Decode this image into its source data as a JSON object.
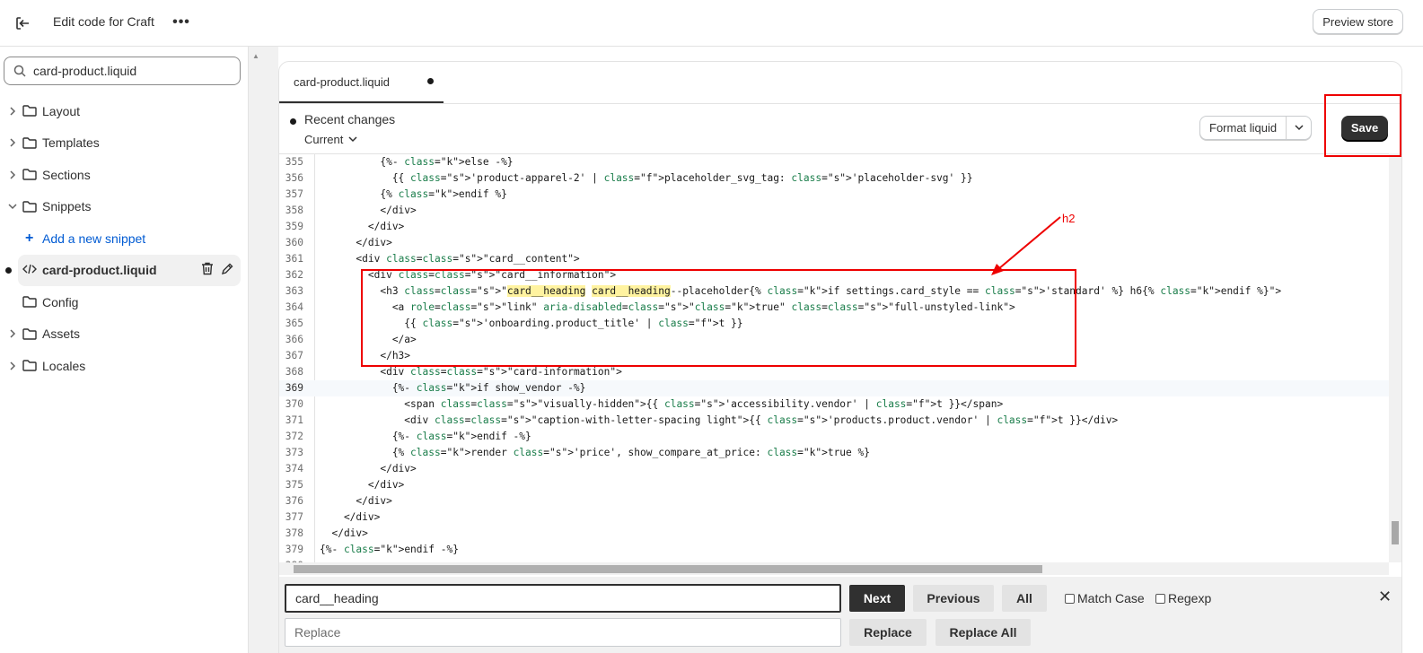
{
  "header": {
    "title": "Edit code for Craft",
    "preview_label": "Preview store"
  },
  "sidebar": {
    "search_value": "card-product.liquid",
    "items": [
      {
        "label": "Layout"
      },
      {
        "label": "Templates"
      },
      {
        "label": "Sections"
      },
      {
        "label": "Snippets"
      },
      {
        "label": "Add a new snippet"
      },
      {
        "label": "card-product.liquid"
      },
      {
        "label": "Config"
      },
      {
        "label": "Assets"
      },
      {
        "label": "Locales"
      }
    ]
  },
  "editor": {
    "tab_label": "card-product.liquid",
    "recent_changes": "Recent changes",
    "version": "Current",
    "format_label": "Format liquid",
    "save_label": "Save",
    "annotation": "h2",
    "code_lines": [
      {
        "n": "355",
        "t": "          {%- else -%}"
      },
      {
        "n": "356",
        "t": "            {{ 'product-apparel-2' | placeholder_svg_tag: 'placeholder-svg' }}"
      },
      {
        "n": "357",
        "t": "          {% endif %}"
      },
      {
        "n": "358",
        "t": "          </div>"
      },
      {
        "n": "359",
        "t": "        </div>"
      },
      {
        "n": "360",
        "t": "      </div>"
      },
      {
        "n": "361",
        "t": "      <div class=\"card__content\">"
      },
      {
        "n": "362",
        "t": "        <div class=\"card__information\">"
      },
      {
        "n": "363",
        "t": "          <h3 class=\"card__heading card__heading--placeholder{% if settings.card_style == 'standard' %} h6{% endif %}\">"
      },
      {
        "n": "364",
        "t": "            <a role=\"link\" aria-disabled=\"true\" class=\"full-unstyled-link\">"
      },
      {
        "n": "365",
        "t": "              {{ 'onboarding.product_title' | t }}"
      },
      {
        "n": "366",
        "t": "            </a>"
      },
      {
        "n": "367",
        "t": "          </h3>"
      },
      {
        "n": "368",
        "t": "          <div class=\"card-information\">"
      },
      {
        "n": "369",
        "t": "            {%- if show_vendor -%}"
      },
      {
        "n": "370",
        "t": "              <span class=\"visually-hidden\">{{ 'accessibility.vendor' | t }}</span>"
      },
      {
        "n": "371",
        "t": "              <div class=\"caption-with-letter-spacing light\">{{ 'products.product.vendor' | t }}</div>"
      },
      {
        "n": "372",
        "t": "            {%- endif -%}"
      },
      {
        "n": "373",
        "t": "            {% render 'price', show_compare_at_price: true %}"
      },
      {
        "n": "374",
        "t": "          </div>"
      },
      {
        "n": "375",
        "t": "        </div>"
      },
      {
        "n": "376",
        "t": "      </div>"
      },
      {
        "n": "377",
        "t": "    </div>"
      },
      {
        "n": "378",
        "t": "  </div>"
      },
      {
        "n": "379",
        "t": "{%- endif -%}"
      },
      {
        "n": "380",
        "t": ""
      }
    ]
  },
  "find": {
    "search_value": "card__heading",
    "replace_placeholder": "Replace",
    "next_label": "Next",
    "previous_label": "Previous",
    "all_label": "All",
    "match_case_label": "Match Case",
    "regexp_label": "Regexp",
    "replace_label": "Replace",
    "replace_all_label": "Replace All"
  }
}
